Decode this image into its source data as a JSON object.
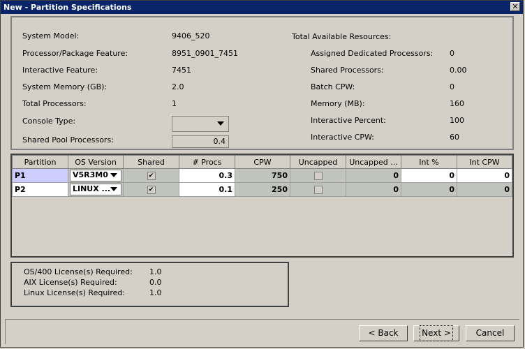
{
  "window": {
    "title": "New - Partition Specifications",
    "close_glyph": "✕"
  },
  "system": {
    "model_label": "System Model:",
    "model_value": "9406_520",
    "proc_feature_label": "Processor/Package Feature:",
    "proc_feature_value": "8951_0901_7451",
    "interactive_feature_label": "Interactive Feature:",
    "interactive_feature_value": "7451",
    "memory_label": "System Memory (GB):",
    "memory_value": "2.0",
    "total_proc_label": "Total Processors:",
    "total_proc_value": "1",
    "console_type_label": "Console Type:",
    "console_type_value": "",
    "shared_pool_label": "Shared Pool Processors:",
    "shared_pool_value": "0.4"
  },
  "resources": {
    "title": "Total Available Resources:",
    "items": [
      {
        "label": "Assigned Dedicated Processors:",
        "value": "0"
      },
      {
        "label": "Shared Processors:",
        "value": "0.00"
      },
      {
        "label": "Batch CPW:",
        "value": "0"
      },
      {
        "label": "Memory (MB):",
        "value": "160"
      },
      {
        "label": "Interactive Percent:",
        "value": "100"
      },
      {
        "label": "Interactive CPW:",
        "value": "60"
      }
    ]
  },
  "table": {
    "headers": [
      "Partition",
      "OS Version",
      "Shared",
      "# Procs",
      "CPW",
      "Uncapped",
      "Uncapped ...",
      "Int %",
      "Int CPW"
    ],
    "rows": [
      {
        "partition": "P1",
        "os": "V5R3M0",
        "shared": "✔",
        "procs": "0.3",
        "cpw": "750",
        "uncapped": "",
        "uncapped2": "0",
        "int_pct": "0",
        "int_cpw": "0"
      },
      {
        "partition": "P2",
        "os": "LINUX ...",
        "shared": "✔",
        "procs": "0.1",
        "cpw": "250",
        "uncapped": "",
        "uncapped2": "0",
        "int_pct": "0",
        "int_cpw": "0"
      }
    ]
  },
  "licenses": [
    {
      "label": "OS/400 License(s) Required:",
      "value": "1.0"
    },
    {
      "label": "AIX License(s) Required:",
      "value": "0.0"
    },
    {
      "label": "Linux License(s) Required:",
      "value": "1.0"
    }
  ],
  "buttons": {
    "back": "< Back",
    "next": "Next >",
    "cancel": "Cancel"
  }
}
